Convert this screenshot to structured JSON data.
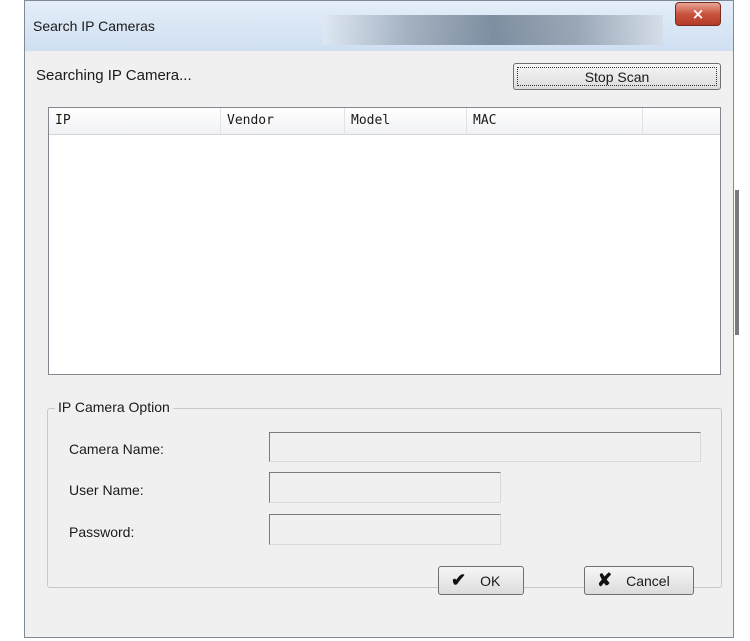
{
  "window": {
    "title": "Search IP Cameras",
    "close_glyph": "×"
  },
  "status_text": "Searching IP Camera...",
  "stop_scan_label": "Stop Scan",
  "camera_list": {
    "columns": [
      "IP",
      "Vendor",
      "Model",
      "MAC"
    ],
    "rows": []
  },
  "ip_camera_option": {
    "legend": "IP Camera Option",
    "camera_name_label": "Camera Name:",
    "camera_name_value": "",
    "user_name_label": "User Name:",
    "user_name_value": "",
    "password_label": "Password:",
    "password_value": ""
  },
  "ok_button": {
    "label": "OK",
    "icon": "checkmark-icon"
  },
  "cancel_button": {
    "label": "Cancel",
    "icon": "x-icon"
  }
}
